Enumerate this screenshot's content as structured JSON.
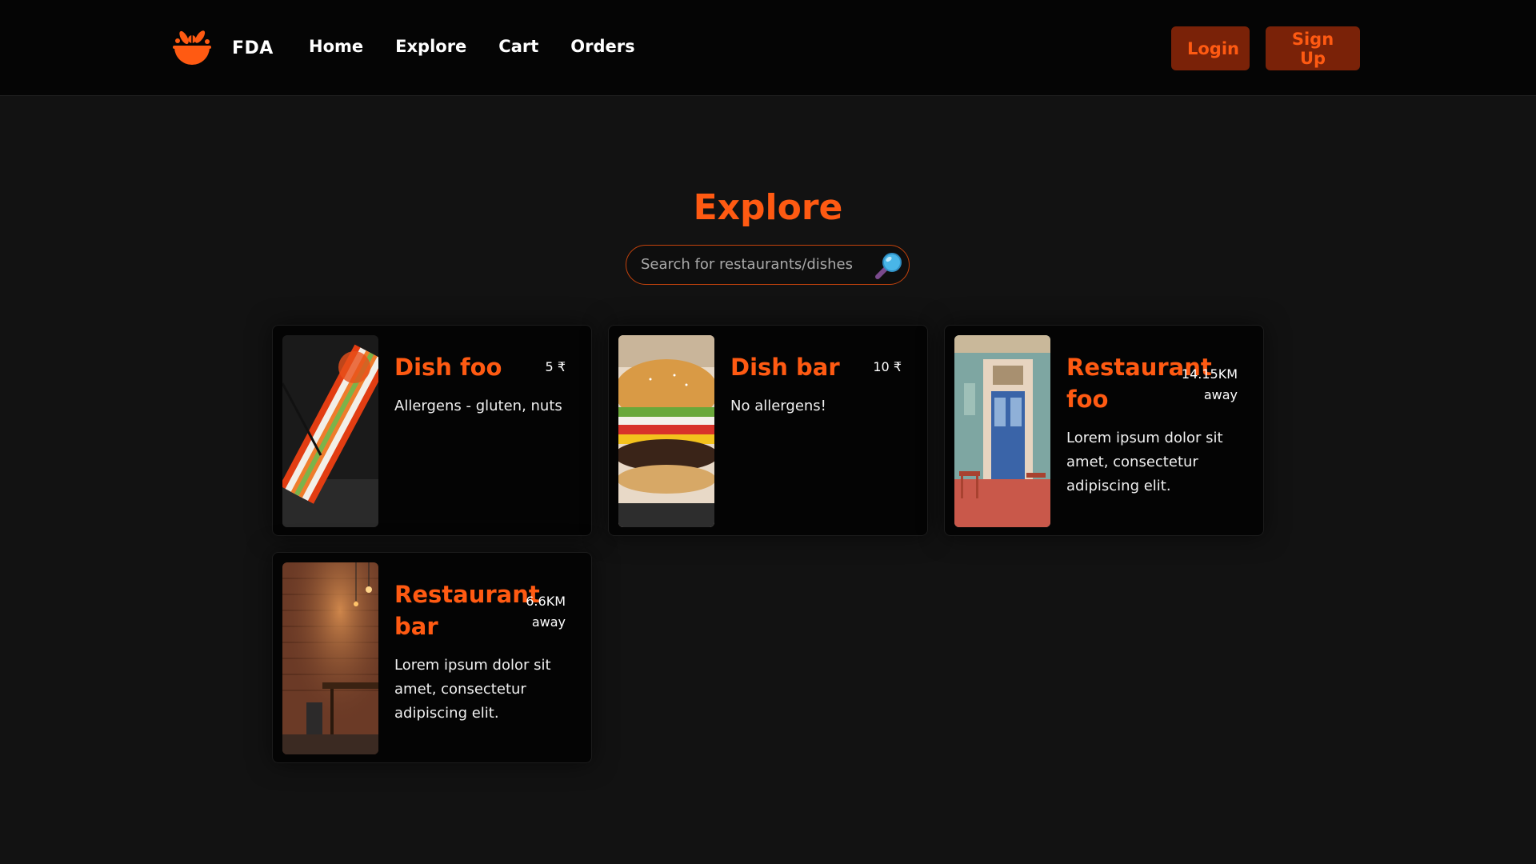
{
  "brand": {
    "name": "FDA",
    "accent": "#ff5a12"
  },
  "nav": {
    "links": [
      "Home",
      "Explore",
      "Cart",
      "Orders"
    ]
  },
  "auth": {
    "login": "Login",
    "signup": "Sign Up"
  },
  "page": {
    "title": "Explore"
  },
  "search": {
    "placeholder": "Search for restaurants/dishes",
    "value": "",
    "icon": "magnifier-icon"
  },
  "cards": [
    {
      "type": "dish",
      "title": "Dish foo",
      "price": "5 ₹",
      "description": "Allergens - gluten, nuts",
      "image": "sushi-photo"
    },
    {
      "type": "dish",
      "title": "Dish bar",
      "price": "10 ₹",
      "description": "No allergens!",
      "image": "burger-photo"
    },
    {
      "type": "restaurant",
      "title": "Restaurant foo",
      "distance": "14.15KM",
      "distance_suffix": "away",
      "description": "Lorem ipsum dolor sit amet, consectetur adipiscing elit.",
      "image": "storefront-photo"
    },
    {
      "type": "restaurant",
      "title": "Restaurant bar",
      "distance": "6.6KM",
      "distance_suffix": "away",
      "description": "Lorem ipsum dolor sit amet, consectetur adipiscing elit.",
      "image": "brick-interior-photo"
    }
  ]
}
